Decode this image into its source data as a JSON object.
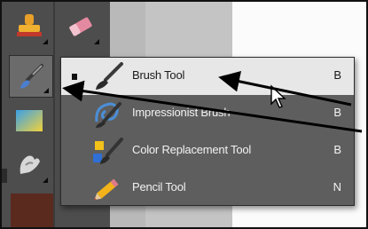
{
  "toolbox": {
    "tools": [
      {
        "name": "stamp-tool",
        "icon": "stamp-icon"
      },
      {
        "name": "eraser-tool",
        "icon": "eraser-icon"
      },
      {
        "name": "brush-tool",
        "icon": "brush-icon",
        "selected": true
      },
      {
        "name": "gradient-tool",
        "icon": "gradient-icon"
      },
      {
        "name": "smudge-tool",
        "icon": "smudge-icon"
      }
    ],
    "foreground_color": "#5a2a1e"
  },
  "flyout": {
    "items": [
      {
        "label": "Brush Tool",
        "shortcut": "B",
        "selected": true,
        "icon": "brush-icon"
      },
      {
        "label": "Impressionist Brush",
        "shortcut": "B",
        "selected": false,
        "icon": "impressionist-brush-icon"
      },
      {
        "label": "Color Replacement Tool",
        "shortcut": "B",
        "selected": false,
        "icon": "color-replacement-icon"
      },
      {
        "label": "Pencil Tool",
        "shortcut": "N",
        "selected": false,
        "icon": "pencil-icon"
      }
    ]
  },
  "colors": {
    "toolbox_bg": "#4d4d4d",
    "flyout_bg": "#5e5e5e",
    "selected_row_bg": "#e7e7e7"
  }
}
